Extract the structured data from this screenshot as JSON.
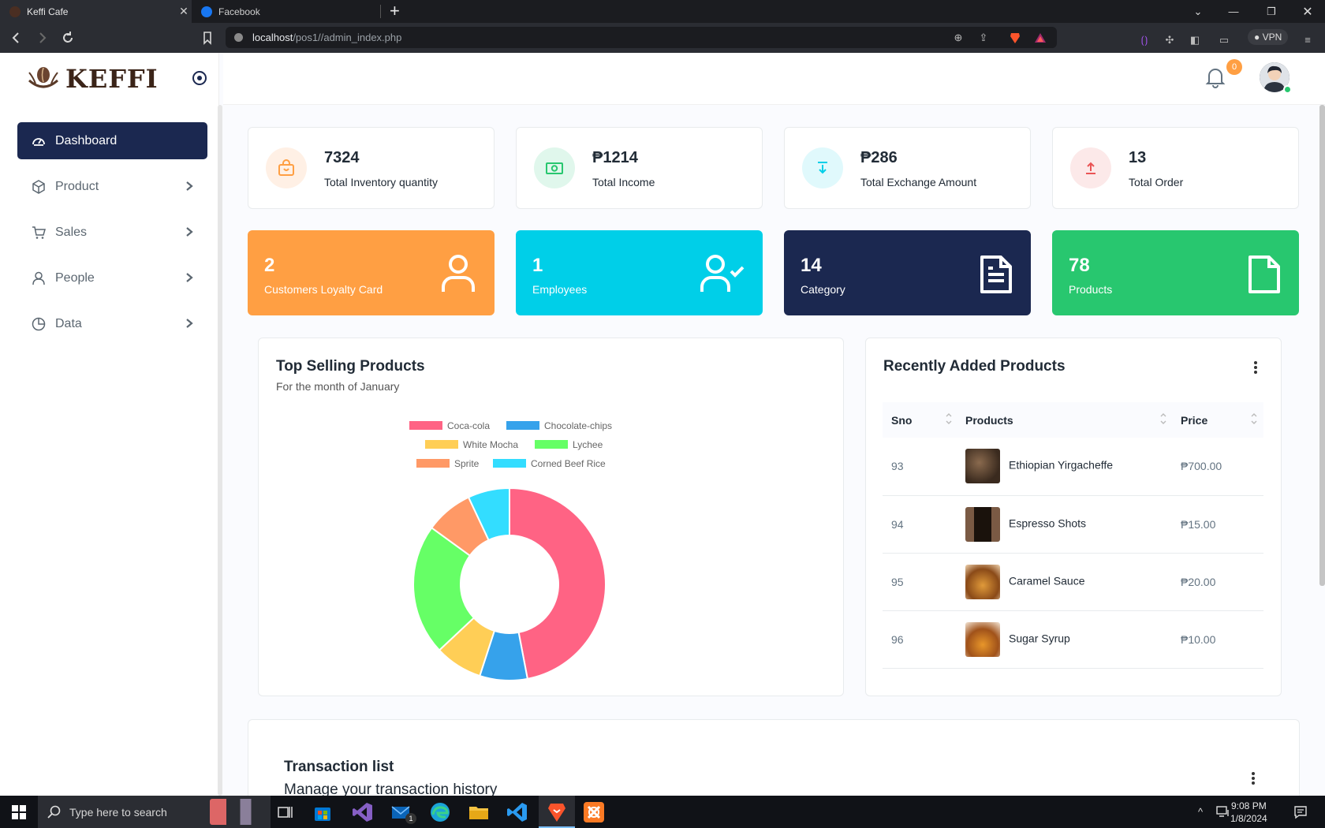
{
  "browser": {
    "tabs": [
      {
        "title": "Keffi Cafe",
        "active": true
      },
      {
        "title": "Facebook",
        "active": false
      }
    ],
    "url_host": "localhost",
    "url_path": "/pos1//admin_index.php",
    "vpn_label": "VPN"
  },
  "brand": {
    "name": "KEFFI"
  },
  "sidebar": {
    "items": [
      {
        "label": "Dashboard",
        "icon": "dashboard-icon",
        "active": true
      },
      {
        "label": "Product",
        "icon": "box-icon"
      },
      {
        "label": "Sales",
        "icon": "cart-icon"
      },
      {
        "label": "People",
        "icon": "user-icon"
      },
      {
        "label": "Data",
        "icon": "pie-chart-icon"
      }
    ]
  },
  "header": {
    "notification_count": "0"
  },
  "stats": [
    {
      "value": "7324",
      "label": "Total Inventory quantity",
      "icon": "shopping-bag-icon",
      "color": "#ff9f43"
    },
    {
      "value": "₱1214",
      "label": "Total Income",
      "icon": "cash-icon",
      "color": "#28c76f"
    },
    {
      "value": "₱286",
      "label": "Total Exchange Amount",
      "icon": "download-icon",
      "color": "#00cfe8"
    },
    {
      "value": "13",
      "label": "Total Order",
      "icon": "upload-icon",
      "color": "#ea5455"
    }
  ],
  "counts": [
    {
      "value": "2",
      "label": "Customers Loyalty Card",
      "icon": "user-icon",
      "color": "#ff9f43"
    },
    {
      "value": "1",
      "label": "Employees",
      "icon": "user-check-icon",
      "color": "#00cfe8"
    },
    {
      "value": "14",
      "label": "Category",
      "icon": "file-text-icon",
      "color": "#1b2850"
    },
    {
      "value": "78",
      "label": "Products",
      "icon": "file-icon",
      "color": "#28c76f"
    }
  ],
  "top_selling": {
    "title": "Top Selling Products",
    "subtitle": "For the month of January"
  },
  "chart_data": {
    "type": "pie",
    "donut": true,
    "title": "Top Selling Products",
    "subtitle": "For the month of January",
    "legend_position": "top",
    "categories": [
      "Coca-cola",
      "Chocolate-chips",
      "White Mocha",
      "Lychee",
      "Sprite",
      "Corned Beef Rice"
    ],
    "values": [
      47,
      8,
      8,
      22,
      8,
      7
    ],
    "colors": [
      "#ff6384",
      "#36a2eb",
      "#ffce56",
      "#66ff66",
      "#ff9966",
      "#33ddff"
    ]
  },
  "recent_products": {
    "title": "Recently Added Products",
    "columns": [
      "Sno",
      "Products",
      "Price"
    ],
    "rows": [
      {
        "sno": "93",
        "name": "Ethiopian Yirgacheffe",
        "price": "₱700.00"
      },
      {
        "sno": "94",
        "name": "Espresso Shots",
        "price": "₱15.00"
      },
      {
        "sno": "95",
        "name": "Caramel Sauce",
        "price": "₱20.00"
      },
      {
        "sno": "96",
        "name": "Sugar Syrup",
        "price": "₱10.00"
      }
    ]
  },
  "transactions": {
    "title": "Transaction list",
    "subtitle": "Manage your transaction history"
  },
  "taskbar": {
    "search_placeholder": "Type here to search",
    "time": "9:08 PM",
    "date": "1/8/2024",
    "mail_badge": "1"
  }
}
